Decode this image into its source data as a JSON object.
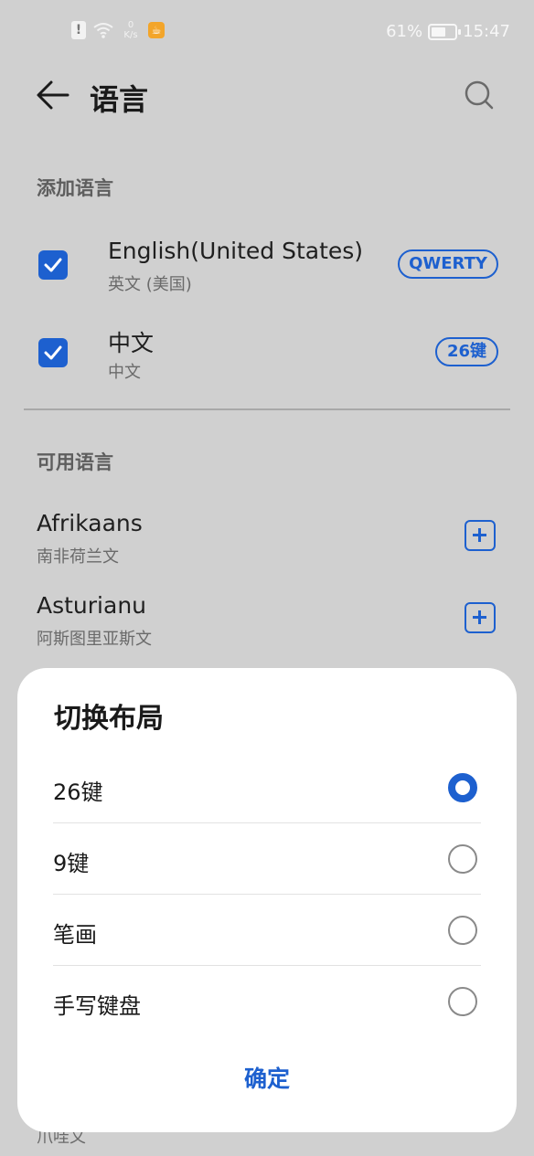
{
  "status_bar": {
    "net_speed_value": "0",
    "net_speed_unit": "K/s",
    "battery_percent": "61%",
    "battery_level": 0.61,
    "time": "15:47"
  },
  "header": {
    "title": "语言",
    "icons": [
      "back-arrow-icon",
      "search-icon"
    ]
  },
  "added_section": {
    "title": "添加语言",
    "languages": [
      {
        "name": "English(United States)",
        "subtitle": "英文 (美国)",
        "layout": "QWERTY",
        "checked": true
      },
      {
        "name": "中文",
        "subtitle": "中文",
        "layout": "26键",
        "checked": true
      }
    ]
  },
  "available_section": {
    "title": "可用语言",
    "languages": [
      {
        "name": "Afrikaans",
        "subtitle": "南非荷兰文"
      },
      {
        "name": "Asturianu",
        "subtitle": "阿斯图里亚斯文"
      }
    ],
    "partial_text": "爪哇文"
  },
  "sheet": {
    "title": "切换布局",
    "options": [
      {
        "label": "26键",
        "selected": true
      },
      {
        "label": "9键",
        "selected": false
      },
      {
        "label": "笔画",
        "selected": false
      },
      {
        "label": "手写键盘",
        "selected": false
      }
    ],
    "confirm_label": "确定"
  },
  "colors": {
    "accent": "#1d60cf",
    "background": "#d0d0d0",
    "sheet": "#ffffff"
  }
}
